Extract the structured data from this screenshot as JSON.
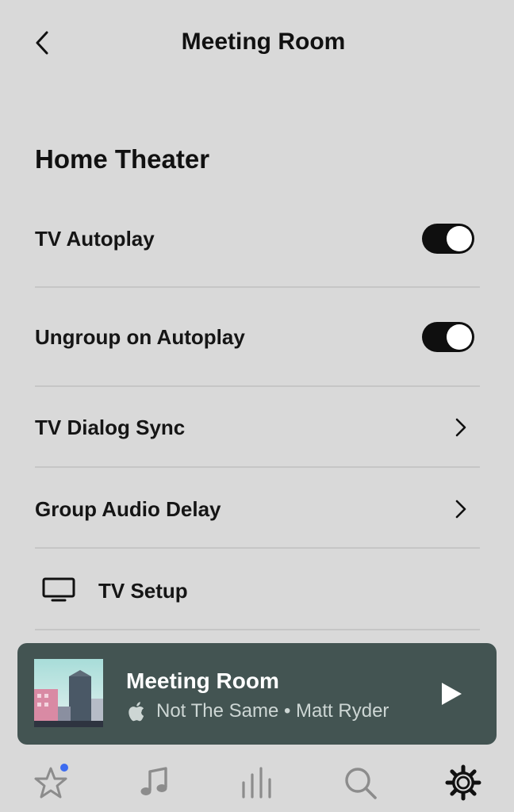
{
  "header": {
    "title": "Meeting Room",
    "back_icon": "chevron-left-icon"
  },
  "section": {
    "title": "Home Theater"
  },
  "settings": [
    {
      "label": "TV Autoplay",
      "control": "toggle",
      "on": true
    },
    {
      "label": "Ungroup on Autoplay",
      "control": "toggle",
      "on": true
    },
    {
      "label": "TV Dialog Sync",
      "control": "chevron"
    },
    {
      "label": "Group Audio Delay",
      "control": "chevron"
    },
    {
      "label": "TV Setup",
      "control": "none",
      "icon": "tv-icon"
    }
  ],
  "now_playing": {
    "room": "Meeting Room",
    "source_icon": "apple-icon",
    "track": "Not The Same • Matt Ryder",
    "play_icon": "play-icon",
    "bg_color": "#435452"
  },
  "tabs": [
    {
      "name": "favorites",
      "icon": "star-icon",
      "badge": true
    },
    {
      "name": "music",
      "icon": "music-note-icon"
    },
    {
      "name": "rooms",
      "icon": "equalizer-bars-icon"
    },
    {
      "name": "search",
      "icon": "search-icon"
    },
    {
      "name": "settings",
      "icon": "gear-icon",
      "active": true
    }
  ],
  "colors": {
    "background": "#d9d9d9",
    "toggle_on": "#0f0f0f",
    "badge": "#3d6cf0"
  }
}
